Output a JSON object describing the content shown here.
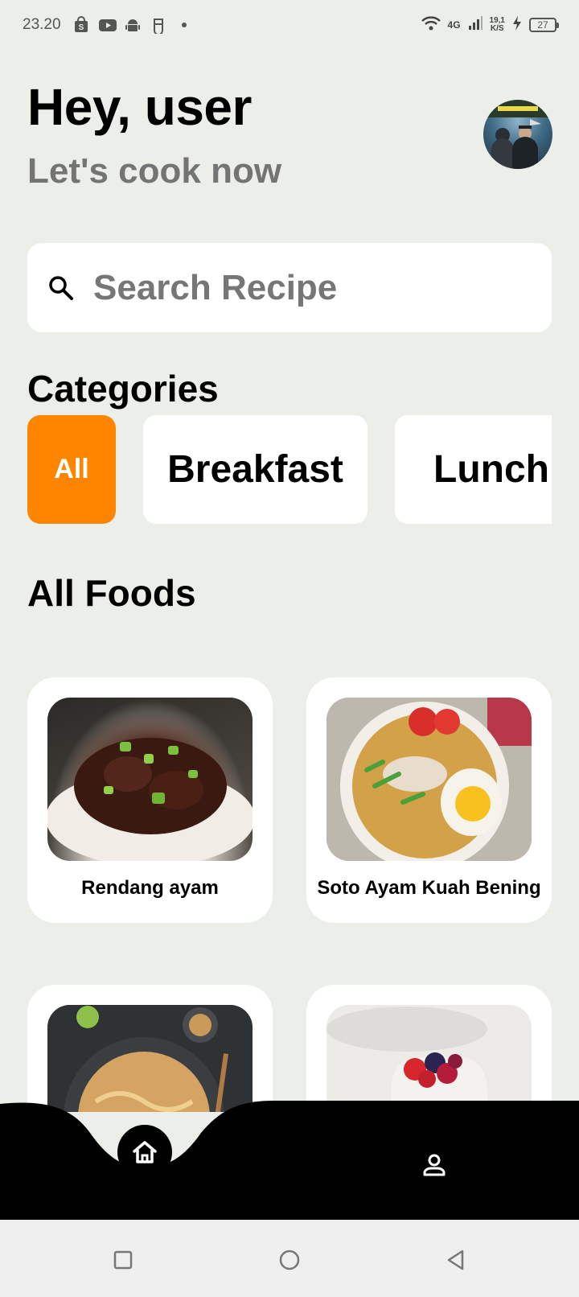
{
  "status_bar": {
    "time": "23.20",
    "network": "4G",
    "speed_value": "19,1",
    "speed_unit": "K/S",
    "battery": "27",
    "icons": [
      "shopping-bag-icon",
      "youtube-icon",
      "android-icon",
      "app-icon",
      "dot-icon",
      "wifi-icon",
      "signal-icon",
      "charging-icon",
      "battery-icon"
    ]
  },
  "header": {
    "greeting": "Hey, user",
    "subtitle": "Let's cook now"
  },
  "search": {
    "placeholder": "Search Recipe",
    "value": ""
  },
  "categories": {
    "title": "Categories",
    "items": [
      {
        "label": "All",
        "active": true
      },
      {
        "label": "Breakfast",
        "active": false
      },
      {
        "label": "Lunch",
        "active": false
      }
    ],
    "active_color": "#ff8500"
  },
  "foods": {
    "title": "All Foods",
    "items": [
      {
        "name": "Rendang ayam"
      },
      {
        "name": "Soto Ayam Kuah Bening"
      },
      {
        "name": ""
      },
      {
        "name": ""
      }
    ]
  },
  "bottom_nav": {
    "items": [
      {
        "icon": "home-icon",
        "active": true
      },
      {
        "icon": "profile-icon",
        "active": false
      }
    ]
  },
  "system_nav": {
    "items": [
      "recent-apps-icon",
      "home-circle-icon",
      "back-icon"
    ]
  }
}
